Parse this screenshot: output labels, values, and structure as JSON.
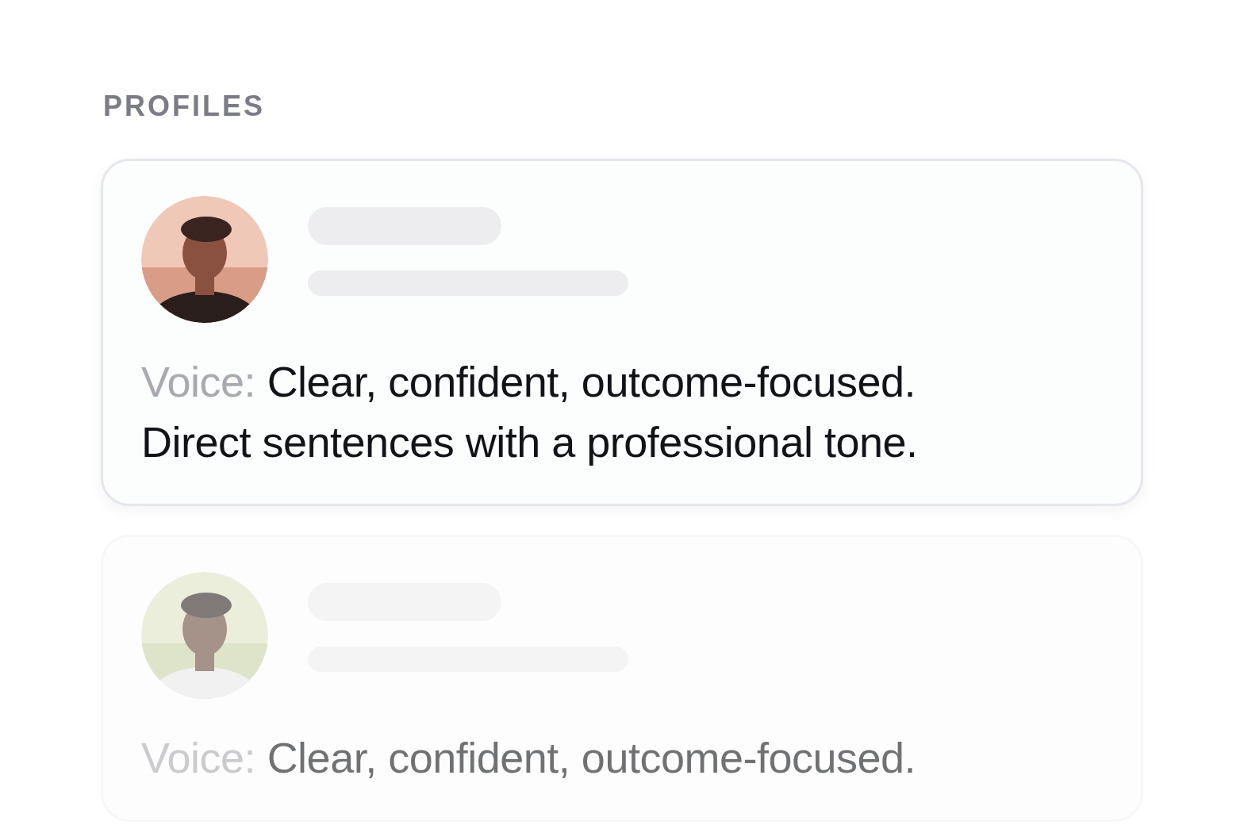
{
  "section_title": "PROFILES",
  "profiles": [
    {
      "voice_label": "Voice:",
      "voice_text": "Clear, confident, outcome-focused. Direct sentences with a professional tone.",
      "faded": false
    },
    {
      "voice_label": "Voice:",
      "voice_text": "Clear, confident, outcome-focused.",
      "faded": true
    }
  ]
}
